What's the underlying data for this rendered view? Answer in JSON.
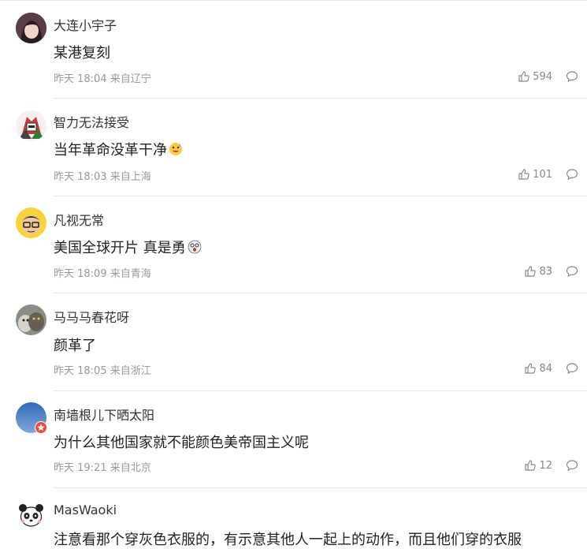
{
  "comments": [
    {
      "name": "大连小宇子",
      "text": "某港复刻",
      "time": "昨天 18:04 来自辽宁",
      "likes": "594",
      "avatar_icon": "anime-girl-avatar-icon"
    },
    {
      "name": "智力无法接受",
      "text": "当年革命没革干净",
      "time": "昨天 18:03 来自上海",
      "likes": "101",
      "avatar_icon": "gundam-robot-avatar-icon",
      "emoji": "sweat-smile-emoji-icon"
    },
    {
      "name": "凡视无常",
      "text": "美国全球开片 真是勇",
      "time": "昨天 18:09 来自青海",
      "likes": "83",
      "avatar_icon": "glasses-cartoon-avatar-icon",
      "emoji": "shocked-cartoon-emoji-icon"
    },
    {
      "name": "马马马春花呀",
      "text": "颜革了",
      "time": "昨天 18:05 来自浙江",
      "likes": "84",
      "avatar_icon": "cats-photo-avatar-icon"
    },
    {
      "name": "南墙根儿下晒太阳",
      "text": "为什么其他国家就不能颜色美帝国主义呢",
      "time": "昨天 19:21 来自北京",
      "likes": "12",
      "avatar_icon": "blue-sky-avatar-icon",
      "badge_icon": "red-star-badge-icon"
    },
    {
      "name": "MasWaoki",
      "text": "注意看那个穿灰色衣服的，有示意其他人一起上的动作，而且他们穿的衣服",
      "avatar_icon": "panda-cartoon-avatar-icon"
    }
  ],
  "colors": {
    "meta": "#999999",
    "divider": "#e5e5e5"
  }
}
